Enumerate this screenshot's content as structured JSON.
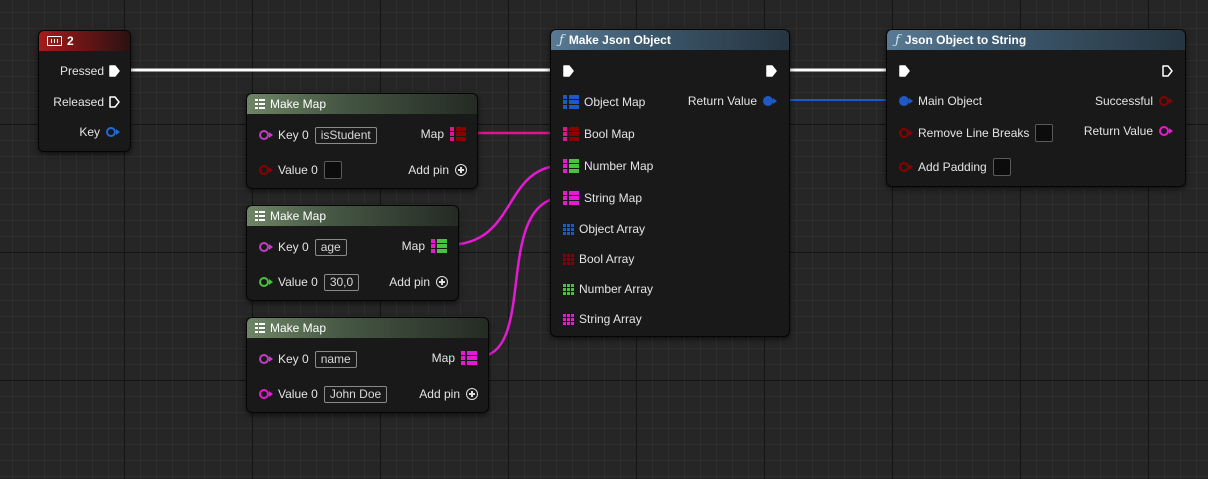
{
  "colors": {
    "exec": "#ffffff",
    "struct": "#1e59c8",
    "bool": "#8c0000",
    "int": "#5ed43c",
    "float": "#47c33d",
    "string": "#f01ad2",
    "name": "#c43cc6"
  },
  "event_node": {
    "title": "2",
    "icon": "keyboard-icon",
    "pins": {
      "pressed": "Pressed",
      "released": "Released",
      "key": "Key"
    }
  },
  "make_json": {
    "title": "Make Json Object",
    "inputs": [
      "Object Map",
      "Bool Map",
      "Number Map",
      "String Map",
      "Object Array",
      "Bool Array",
      "Number Array",
      "String Array"
    ],
    "output": "Return Value"
  },
  "json_to_string": {
    "title": "Json Object to String",
    "inputs": {
      "main": "Main Object",
      "remove": "Remove Line Breaks",
      "padding": "Add Padding"
    },
    "outputs": {
      "successful": "Successful",
      "return": "Return Value"
    }
  },
  "make_map_1": {
    "title": "Make Map",
    "key_label": "Key 0",
    "key_value": "isStudent",
    "value_label": "Value 0",
    "map": "Map",
    "add_pin": "Add pin"
  },
  "make_map_2": {
    "title": "Make Map",
    "key_label": "Key 0",
    "key_value": "age",
    "value_label": "Value 0",
    "value_value": "30,0",
    "map": "Map",
    "add_pin": "Add pin"
  },
  "make_map_3": {
    "title": "Make Map",
    "key_label": "Key 0",
    "key_value": "name",
    "value_label": "Value 0",
    "value_value": "John Doe",
    "map": "Map",
    "add_pin": "Add pin"
  }
}
